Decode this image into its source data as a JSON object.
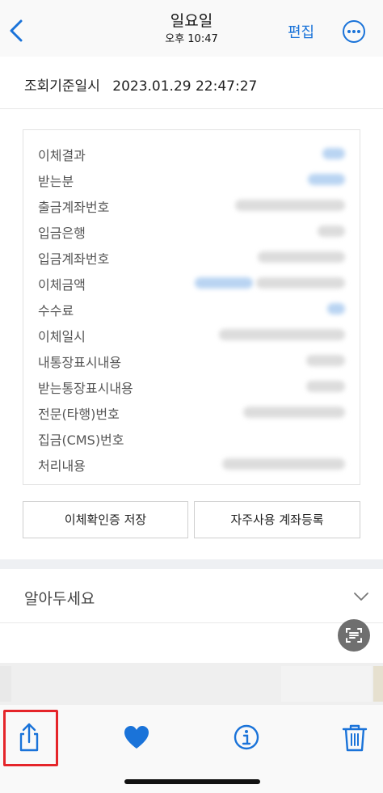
{
  "nav": {
    "title": "일요일",
    "subtitle": "오후 10:47",
    "edit_label": "편집"
  },
  "header": {
    "label": "조회기준일시",
    "datetime": "2023.01.29 22:47:27"
  },
  "details": {
    "labels": [
      "이체결과",
      "받는분",
      "출금계좌번호",
      "입금은행",
      "입금계좌번호",
      "이체금액",
      "수수료",
      "이체일시",
      "내통장표시내용",
      "받는통장표시내용",
      "전문(타행)번호",
      "집금(CMS)번호",
      "처리내용"
    ]
  },
  "actions": {
    "save_label": "이체확인증 저장",
    "register_label": "자주사용 계좌등록"
  },
  "notice": {
    "label": "알아두세요"
  },
  "colors": {
    "accent": "#1a73d9",
    "highlight": "#e5252a"
  },
  "icons": {
    "back": "chevron-left-icon",
    "more": "more-circle-icon",
    "share": "share-icon",
    "favorite": "heart-icon",
    "info": "info-icon",
    "delete": "trash-icon",
    "scan": "live-text-icon"
  }
}
